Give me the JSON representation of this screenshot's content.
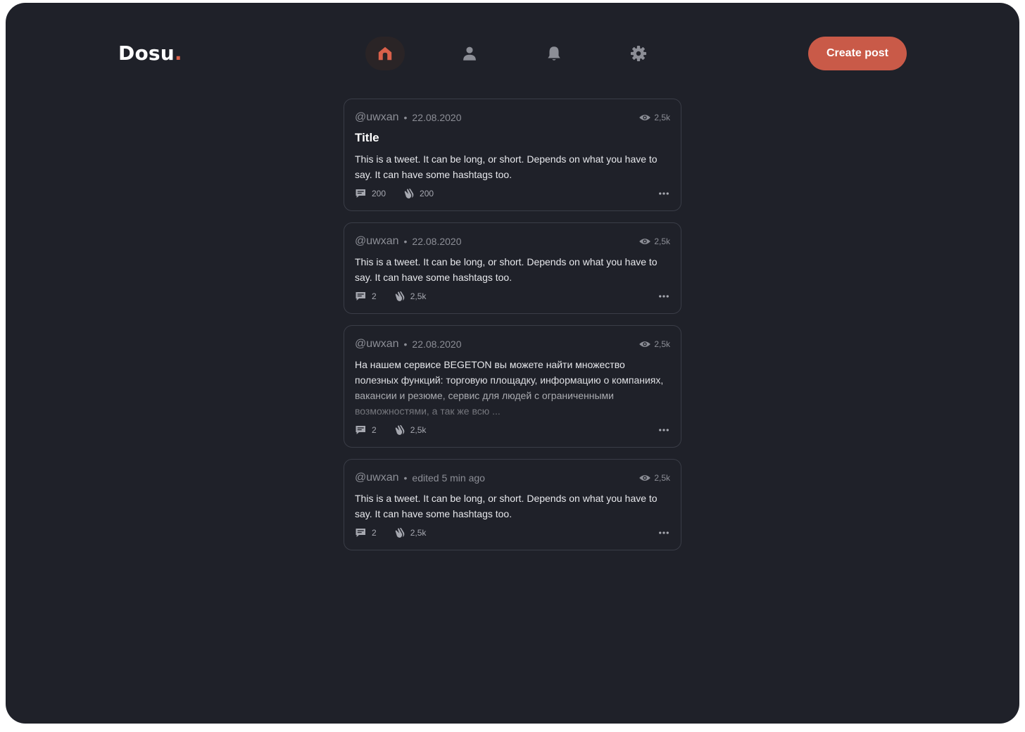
{
  "brand": {
    "name": "Dosu",
    "dot": "."
  },
  "nav": [
    {
      "id": "home",
      "icon": "home-icon",
      "active": true
    },
    {
      "id": "profile",
      "icon": "user-icon",
      "active": false
    },
    {
      "id": "notifications",
      "icon": "bell-icon",
      "active": false
    },
    {
      "id": "settings",
      "icon": "gear-icon",
      "active": false
    }
  ],
  "actions": {
    "create_label": "Create post"
  },
  "colors": {
    "background": "#1f2129",
    "accent": "#c95a48",
    "card_border": "#3a3d47"
  },
  "posts": [
    {
      "author": "@uwxan",
      "separator": "•",
      "date": "22.08.2020",
      "views": "2,5k",
      "title": "Title",
      "body": "This is a tweet. It can be long, or short. Depends on what you have to say. It can have some hashtags too.",
      "comments": "200",
      "claps": "200"
    },
    {
      "author": "@uwxan",
      "separator": "•",
      "date": "22.08.2020",
      "views": "2,5k",
      "body": "This is a tweet. It can be long, or short. Depends on what you have to say. It can have some hashtags too.",
      "comments": "2",
      "claps": "2,5k"
    },
    {
      "author": "@uwxan",
      "separator": "•",
      "date": "22.08.2020",
      "views": "2,5k",
      "body": "На нашем сервисе BEGETON вы можете найти множество полезных функций: торговую площадку, информацию о компаниях, вакансии и резюме, сервис для людей с ограниченными возможностями, а так же всю ...",
      "comments": "2",
      "claps": "2,5k"
    },
    {
      "author": "@uwxan",
      "separator": "•",
      "date": "edited 5 min ago",
      "views": "2,5k",
      "body": "This is a tweet. It can be long, or short. Depends on what you have to say. It can have some hashtags too.",
      "comments": "2",
      "claps": "2,5k"
    }
  ]
}
